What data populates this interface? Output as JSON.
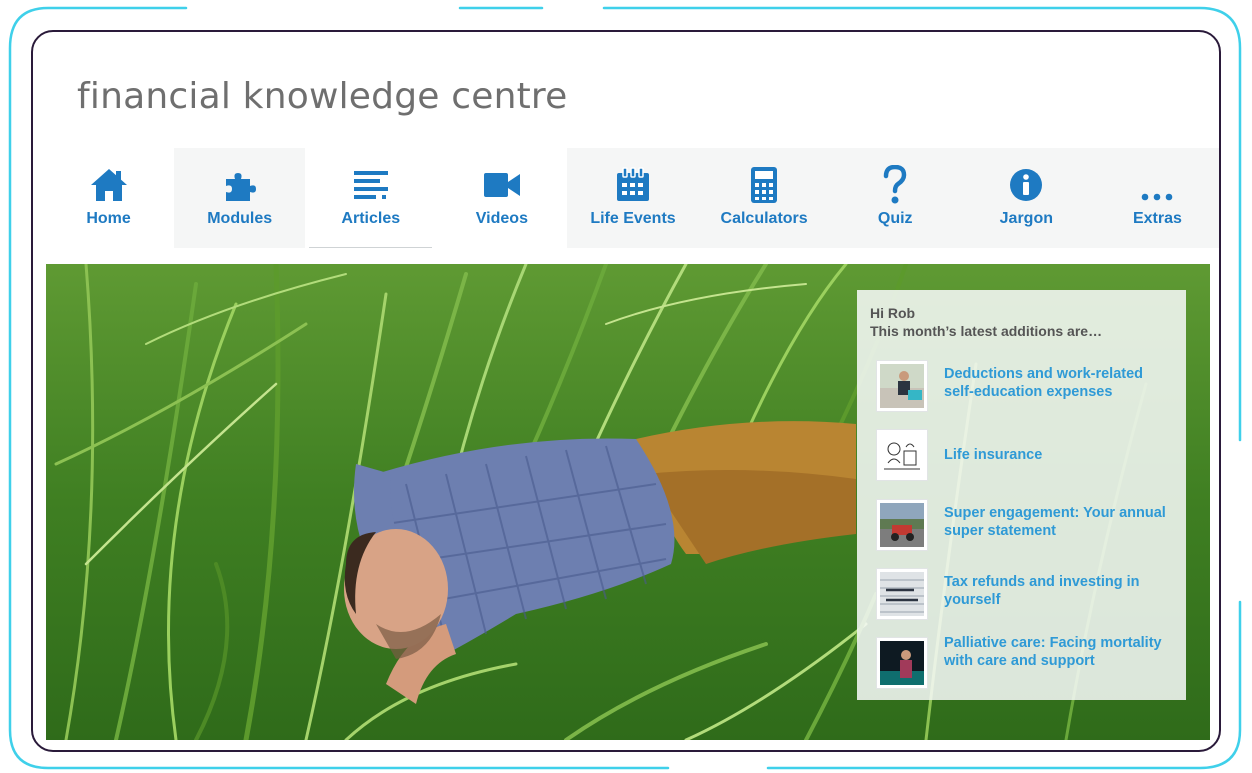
{
  "site": {
    "title": "financial knowledge centre"
  },
  "nav": {
    "items": [
      {
        "label": "Home",
        "icon": "home-icon"
      },
      {
        "label": "Modules",
        "icon": "puzzle-icon"
      },
      {
        "label": "Articles",
        "icon": "article-lines-icon"
      },
      {
        "label": "Videos",
        "icon": "video-camera-icon"
      },
      {
        "label": "Life Events",
        "icon": "calendar-icon"
      },
      {
        "label": "Calculators",
        "icon": "calculator-icon"
      },
      {
        "label": "Quiz",
        "icon": "question-mark-icon"
      },
      {
        "label": "Jargon",
        "icon": "info-icon"
      },
      {
        "label": "Extras",
        "icon": "more-dots-icon"
      }
    ],
    "active": "Articles"
  },
  "panel": {
    "greeting": "Hi Rob",
    "subtitle": "This month’s latest additions are…",
    "items": [
      {
        "title": "Deductions and work-related self-education expenses"
      },
      {
        "title": "Life insurance"
      },
      {
        "title": "Super engagement: Your annual super statement"
      },
      {
        "title": "Tax refunds and investing in yourself"
      },
      {
        "title": "Palliative care: Facing mortality with care and support"
      }
    ]
  },
  "colors": {
    "nav_blue": "#1e7ac2",
    "link_blue": "#2f9ad6",
    "frame_cyan": "#3fd0ea",
    "frame_dark": "#2a1a3a"
  }
}
